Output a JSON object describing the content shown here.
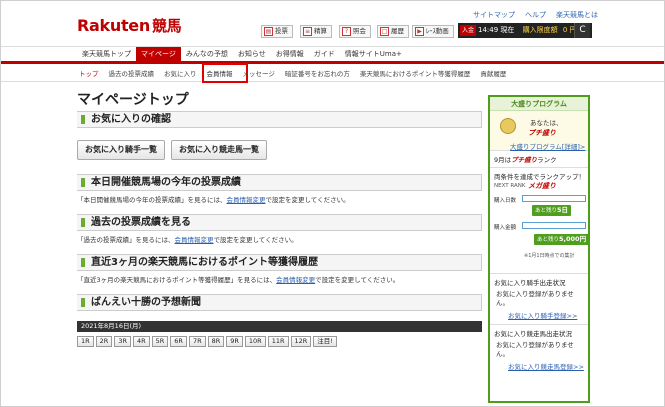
{
  "header": {
    "logo_main": "Rakuten",
    "logo_sub": "競馬",
    "top_links": [
      "サイトマップ",
      "ヘルプ",
      "楽天競馬とは"
    ],
    "buttons": [
      {
        "icon": "▤",
        "label": "投票"
      },
      {
        "icon": "≡",
        "label": "精算"
      },
      {
        "icon": "?",
        "label": "照会"
      },
      {
        "icon": "□",
        "label": "履歴"
      },
      {
        "icon": "▶",
        "label": "ﾚｰｽ動画"
      }
    ],
    "account": {
      "badge": "入金",
      "time": "14:49 現在",
      "points_label": "購入限度額",
      "points_value": "0 円"
    },
    "reload_icon": "C"
  },
  "main_nav": {
    "items": [
      "楽天競馬トップ",
      "マイページ",
      "みんなの予想",
      "お知らせ",
      "お得情報",
      "ガイド",
      "情報サイトUma+"
    ],
    "active_index": 1
  },
  "sub_nav": {
    "items": [
      "トップ",
      "過去の投票成績",
      "お気に入り",
      "会員情報",
      "メッセージ",
      "暗証番号をお忘れの方",
      "楽天競馬におけるポイント等獲得履歴",
      "貢献履歴"
    ],
    "current_index": 0,
    "highlight_index": 3
  },
  "main": {
    "page_title": "マイページトップ",
    "sections": [
      {
        "title": "お気に入りの確認"
      },
      {
        "title": "本日開催競馬場の今年の投票成績"
      },
      {
        "title": "過去の投票成績を見る"
      },
      {
        "title": "直近3ヶ月の楽天競馬におけるポイント等獲得履歴"
      },
      {
        "title": "ばんえい十勝の予想新聞"
      }
    ],
    "fav_buttons": [
      "お気に入り騎手一覧",
      "お気に入り競走馬一覧"
    ],
    "notes": [
      {
        "pre": "「本日開催競馬場の今年の投票成績」を見るには、",
        "link": "会員情報変更",
        "post": "で設定を変更してください。"
      },
      {
        "pre": "「過去の投票成績」を見るには、",
        "link": "会員情報変更",
        "post": "で設定を変更してください。"
      },
      {
        "pre": "「直近3ヶ月の楽天競馬におけるポイント等獲得履歴」を見るには、",
        "link": "会員情報変更",
        "post": "で設定を変更してください。"
      }
    ],
    "date": "2021年8月16日(月)",
    "races": [
      "1R",
      "2R",
      "3R",
      "4R",
      "5R",
      "6R",
      "7R",
      "8R",
      "9R",
      "10R",
      "11R",
      "12R",
      "注目!"
    ]
  },
  "sidebar": {
    "program_title": "大盛りプログラム",
    "you_are": "あなたは、",
    "rank_name": "プチ盛り",
    "program_link": "大盛りプログラム[詳細]>",
    "current_rank_prefix": "9月は",
    "current_rank": "プチ盛り",
    "current_rank_suffix": "ランク",
    "goal_lead": "両条件を達成でランクアップ！",
    "next_rank_label": "NEXT RANK",
    "next_rank": "メガ盛り",
    "days_label": "購入日数",
    "days_remaining_pre": "あと残り",
    "days_remaining": "5日",
    "amount_label": "購入金額",
    "amount_remaining_pre": "あと残り",
    "amount_remaining": "5,000円",
    "goal_footnote": "※1月1日時点での集計",
    "fav_jockey_title": "お気に入り騎手出走状況",
    "fav_jockey_body": "お気に入り登録がありません。",
    "fav_jockey_link": "お気に入り騎手登録>>",
    "fav_horse_title": "お気に入り競走馬出走状況",
    "fav_horse_body": "お気に入り登録がありません。",
    "fav_horse_link": "お気に入り競走馬登録>>"
  }
}
